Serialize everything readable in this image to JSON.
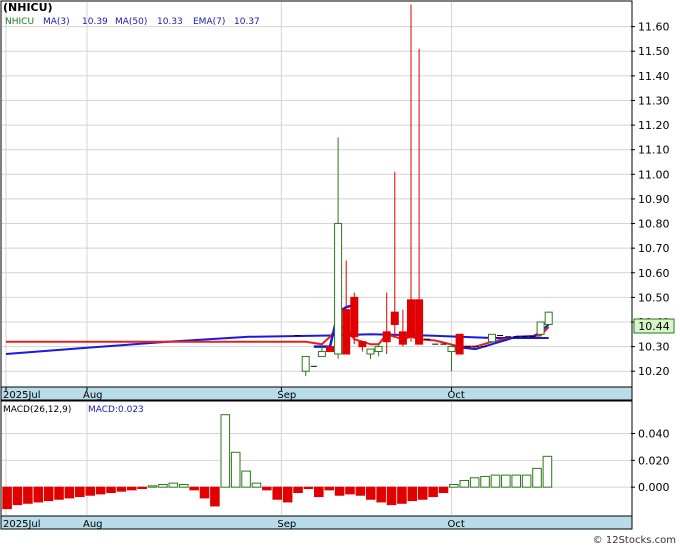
{
  "title": "(NHICU)",
  "legend": {
    "symbol": "NHICU",
    "ma3": "MA(3)",
    "ma3_value": "10.39",
    "ma50": "MA(50)",
    "ma50_value": "10.33",
    "ema7": "EMA(7)",
    "ema7_value": "10.37"
  },
  "watermark": "© 12Stocks.com",
  "colors": {
    "up": "#2a7a1a",
    "down": "#e00000",
    "ma": "#1a1adc",
    "ema": "#e8201a",
    "axis_band": "#b8dcea",
    "grid": "#d4d4d4",
    "legend_symbol": "#1a7a1a",
    "legend_ma": "#1a1ab0",
    "price_label_bg": "#d6f5c8"
  },
  "chart_data": [
    {
      "type": "candlestick",
      "panel": "price",
      "x_tick_labels": [
        "2025Jul",
        "Aug",
        "Sep",
        "Oct"
      ],
      "y_tick_labels": [
        "10.20",
        "10.30",
        "10.40",
        "10.50",
        "10.60",
        "10.70",
        "10.80",
        "10.90",
        "11.00",
        "11.10",
        "11.20",
        "11.30",
        "11.40",
        "11.50",
        "11.60"
      ],
      "ylim": [
        10.14,
        11.7
      ],
      "last_price_label": "10.44",
      "candles": [
        {
          "t": 36,
          "o": 10.345,
          "h": 10.345,
          "l": 10.345,
          "c": 10.345
        },
        {
          "t": 37,
          "o": 10.2,
          "h": 10.26,
          "l": 10.18,
          "c": 10.26
        },
        {
          "t": 38,
          "o": 10.22,
          "h": 10.22,
          "l": 10.22,
          "c": 10.22
        },
        {
          "t": 39,
          "o": 10.26,
          "h": 10.3,
          "l": 10.26,
          "c": 10.28
        },
        {
          "t": 40,
          "o": 10.3,
          "h": 10.3,
          "l": 10.28,
          "c": 10.28
        },
        {
          "t": 41,
          "o": 10.27,
          "h": 11.15,
          "l": 10.25,
          "c": 10.8
        },
        {
          "t": 42,
          "o": 10.45,
          "h": 10.65,
          "l": 10.27,
          "c": 10.27
        },
        {
          "t": 43,
          "o": 10.5,
          "h": 10.52,
          "l": 10.31,
          "c": 10.34
        },
        {
          "t": 44,
          "o": 10.32,
          "h": 10.32,
          "l": 10.28,
          "c": 10.3
        },
        {
          "t": 45,
          "o": 10.27,
          "h": 10.29,
          "l": 10.25,
          "c": 10.29
        },
        {
          "t": 46,
          "o": 10.28,
          "h": 10.31,
          "l": 10.26,
          "c": 10.3
        },
        {
          "t": 47,
          "o": 10.36,
          "h": 10.52,
          "l": 10.27,
          "c": 10.32
        },
        {
          "t": 48,
          "o": 10.44,
          "h": 11.01,
          "l": 10.34,
          "c": 10.39
        },
        {
          "t": 49,
          "o": 10.36,
          "h": 10.45,
          "l": 10.3,
          "c": 10.31
        },
        {
          "t": 50,
          "o": 10.49,
          "h": 11.69,
          "l": 10.32,
          "c": 10.34
        },
        {
          "t": 51,
          "o": 10.49,
          "h": 11.51,
          "l": 10.32,
          "c": 10.31
        },
        {
          "t": 52,
          "o": 10.33,
          "h": 10.33,
          "l": 10.33,
          "c": 10.33
        },
        {
          "t": 53,
          "o": 10.31,
          "h": 10.31,
          "l": 10.31,
          "c": 10.31
        },
        {
          "t": 54,
          "o": 10.31,
          "h": 10.31,
          "l": 10.31,
          "c": 10.31
        },
        {
          "t": 55,
          "o": 10.28,
          "h": 10.3,
          "l": 10.2,
          "c": 10.3
        },
        {
          "t": 56,
          "o": 10.35,
          "h": 10.35,
          "l": 10.27,
          "c": 10.27
        },
        {
          "t": 57,
          "o": 10.3,
          "h": 10.3,
          "l": 10.3,
          "c": 10.3
        },
        {
          "t": 58,
          "o": 10.3,
          "h": 10.3,
          "l": 10.3,
          "c": 10.3
        },
        {
          "t": 59,
          "o": 10.3,
          "h": 10.3,
          "l": 10.3,
          "c": 10.3
        },
        {
          "t": 60,
          "o": 10.32,
          "h": 10.35,
          "l": 10.32,
          "c": 10.35
        },
        {
          "t": 61,
          "o": 10.345,
          "h": 10.345,
          "l": 10.345,
          "c": 10.345
        },
        {
          "t": 62,
          "o": 10.34,
          "h": 10.34,
          "l": 10.34,
          "c": 10.34
        },
        {
          "t": 63,
          "o": 10.34,
          "h": 10.34,
          "l": 10.34,
          "c": 10.34
        },
        {
          "t": 64,
          "o": 10.34,
          "h": 10.34,
          "l": 10.34,
          "c": 10.34
        },
        {
          "t": 65,
          "o": 10.34,
          "h": 10.34,
          "l": 10.34,
          "c": 10.34
        },
        {
          "t": 66,
          "o": 10.35,
          "h": 10.4,
          "l": 10.35,
          "c": 10.4
        },
        {
          "t": 67,
          "o": 10.39,
          "h": 10.44,
          "l": 10.39,
          "c": 10.44
        }
      ],
      "ma50_line": [
        [
          0,
          10.27
        ],
        [
          10,
          10.295
        ],
        [
          20,
          10.32
        ],
        [
          30,
          10.34
        ],
        [
          40,
          10.345
        ],
        [
          45,
          10.35
        ],
        [
          52,
          10.345
        ],
        [
          60,
          10.335
        ],
        [
          67,
          10.335
        ]
      ],
      "ema_line": [
        [
          0,
          10.32
        ],
        [
          30,
          10.32
        ],
        [
          37,
          10.32
        ],
        [
          39,
          10.31
        ],
        [
          40,
          10.34
        ],
        [
          41,
          10.38
        ],
        [
          42,
          10.38
        ],
        [
          43,
          10.33
        ],
        [
          45,
          10.31
        ],
        [
          46,
          10.31
        ],
        [
          47,
          10.35
        ],
        [
          48,
          10.34
        ],
        [
          49,
          10.33
        ],
        [
          50,
          10.34
        ],
        [
          51,
          10.33
        ],
        [
          53,
          10.325
        ],
        [
          56,
          10.3
        ],
        [
          58,
          10.3
        ],
        [
          60,
          10.32
        ],
        [
          63,
          10.34
        ],
        [
          66,
          10.345
        ],
        [
          67,
          10.38
        ]
      ],
      "ma3_line": [
        [
          38,
          10.3
        ],
        [
          40,
          10.3
        ],
        [
          41,
          10.44
        ],
        [
          42,
          10.46
        ],
        [
          43,
          10.47
        ]
      ],
      "ma3_tail": [
        [
          55,
          10.3
        ],
        [
          58,
          10.29
        ],
        [
          60,
          10.31
        ],
        [
          63,
          10.34
        ],
        [
          65,
          10.34
        ],
        [
          66,
          10.36
        ],
        [
          67,
          10.39
        ]
      ]
    },
    {
      "type": "bar",
      "panel": "macd",
      "title": "MACD(26,12,9)",
      "legend_value": "MACD:0.023",
      "x_tick_labels": [
        "2025Jul",
        "Aug",
        "Sep",
        "Oct"
      ],
      "y_tick_labels": [
        "0.000",
        "0.020",
        "0.040"
      ],
      "ylim": [
        -0.02,
        0.062
      ],
      "values": [
        -0.016,
        -0.013,
        -0.012,
        -0.011,
        -0.01,
        -0.009,
        -0.008,
        -0.007,
        -0.006,
        -0.005,
        -0.004,
        -0.003,
        -0.002,
        -0.001,
        0.001,
        0.002,
        0.003,
        0.002,
        -0.002,
        -0.008,
        -0.014,
        0.054,
        0.026,
        0.012,
        0.003,
        -0.002,
        -0.009,
        -0.011,
        -0.004,
        -0.001,
        -0.007,
        -0.002,
        -0.006,
        -0.005,
        -0.006,
        -0.009,
        -0.011,
        -0.013,
        -0.012,
        -0.01,
        -0.009,
        -0.007,
        -0.004,
        0.002,
        0.005,
        0.007,
        0.008,
        0.009,
        0.009,
        0.009,
        0.009,
        0.014,
        0.023
      ]
    }
  ]
}
